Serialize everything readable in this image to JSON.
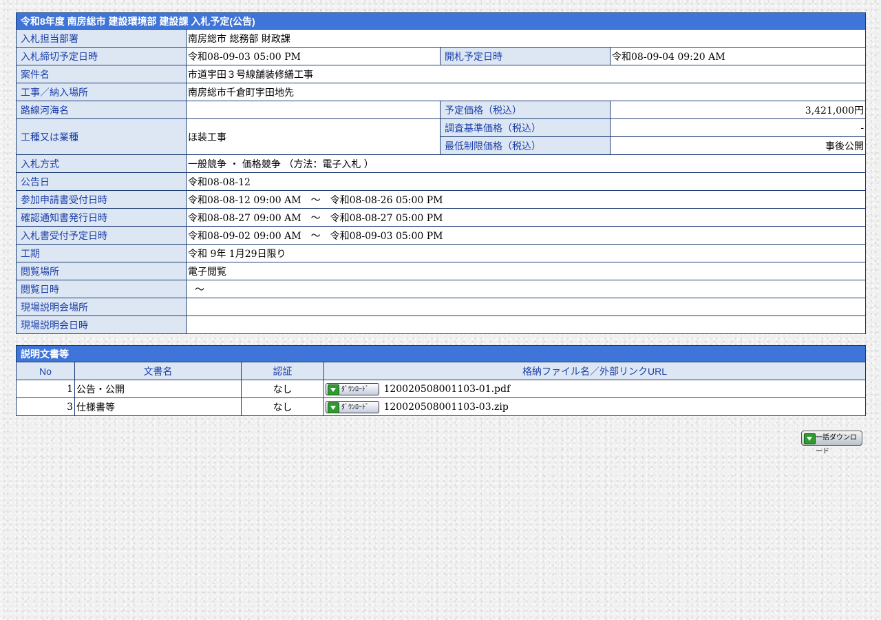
{
  "info": {
    "title": "令和8年度 南房総市 建設環境部 建設課 入札予定(公告)",
    "dept_label": "入札担当部署",
    "dept_value": "南房総市 総務部 財政課",
    "deadline_label": "入札締切予定日時",
    "deadline_value": "令和08-09-03 05:00 PM",
    "opening_label": "開札予定日時",
    "opening_value": "令和08-09-04 09:20 AM",
    "project_label": "案件名",
    "project_value": "市道宇田３号線舗装修繕工事",
    "location_label": "工事／納入場所",
    "location_value": "南房総市千倉町宇田地先",
    "route_label": "路線河海名",
    "route_value": "",
    "est_price_label": "予定価格（税込）",
    "est_price_value": "3,421,000円",
    "type_label": "工種又は業種",
    "type_value": "ほ装工事",
    "survey_price_label": "調査基準価格（税込）",
    "survey_price_value": "-",
    "min_price_label": "最低制限価格（税込）",
    "min_price_value": "事後公開",
    "method_label": "入札方式",
    "method_value": "一般競争 ・ 価格競争 （方法：電子入札 ）",
    "notice_label": "公告日",
    "notice_value": "令和08-08-12",
    "apply_label": "参加申請書受付日時",
    "apply_value": "令和08-08-12 09:00 AM　～　令和08-08-26 05:00 PM",
    "confirm_label": "確認通知書発行日時",
    "confirm_value": "令和08-08-27 09:00 AM　～　令和08-08-27 05:00 PM",
    "bid_recv_label": "入札書受付予定日時",
    "bid_recv_value": "令和08-09-02 09:00 AM　～　令和08-09-03 05:00 PM",
    "period_label": "工期",
    "period_value": "令和 9年 1月29日限り",
    "view_place_label": "閲覧場所",
    "view_place_value": "電子閲覧",
    "view_time_label": "閲覧日時",
    "view_time_value": "～",
    "site_place_label": "現場説明会場所",
    "site_place_value": "",
    "site_time_label": "現場説明会日時",
    "site_time_value": ""
  },
  "docs": {
    "title": "説明文書等",
    "col_no": "No",
    "col_name": "文書名",
    "col_auth": "認証",
    "col_file": "格納ファイル名／外部リンクURL",
    "download_label": "ﾀﾞｳﾝﾛｰﾄﾞ",
    "rows": [
      {
        "no": "1",
        "name": "公告・公開",
        "auth": "なし",
        "file": "120020508001103-01.pdf"
      },
      {
        "no": "3",
        "name": "仕様書等",
        "auth": "なし",
        "file": "120020508001103-03.zip"
      }
    ]
  },
  "bulk_download_label": "一括ダウンロード",
  "colors": {
    "header": "#3f74d8",
    "label_bg": "#dde7f4",
    "label_text": "#1c3fa8",
    "border": "#1a3a72"
  }
}
